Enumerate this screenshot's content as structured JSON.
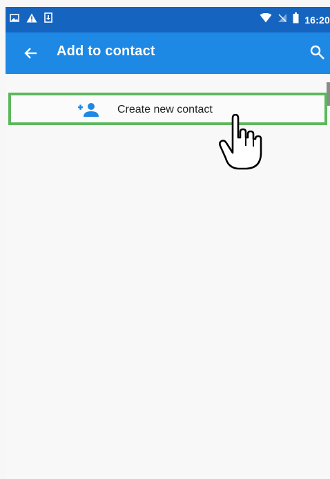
{
  "status_bar": {
    "time": "16:20",
    "left_icons": [
      "image-icon",
      "warning-icon",
      "download-icon"
    ],
    "right_icons": [
      "wifi-icon",
      "no-sim-icon",
      "battery-icon"
    ]
  },
  "app_bar": {
    "title": "Add to contact",
    "back_icon": "arrow-back-icon",
    "search_icon": "search-icon"
  },
  "list": {
    "items": [
      {
        "label": "Create new contact",
        "icon": "add-person-icon",
        "highlighted": true
      }
    ]
  },
  "overlay": {
    "cursor": "hand-pointer-icon"
  },
  "colors": {
    "status_bar": "#1565c0",
    "app_bar": "#1e88e5",
    "highlight_border": "#5cb85c",
    "accent": "#1e88e5",
    "background": "#f8f8f8"
  }
}
